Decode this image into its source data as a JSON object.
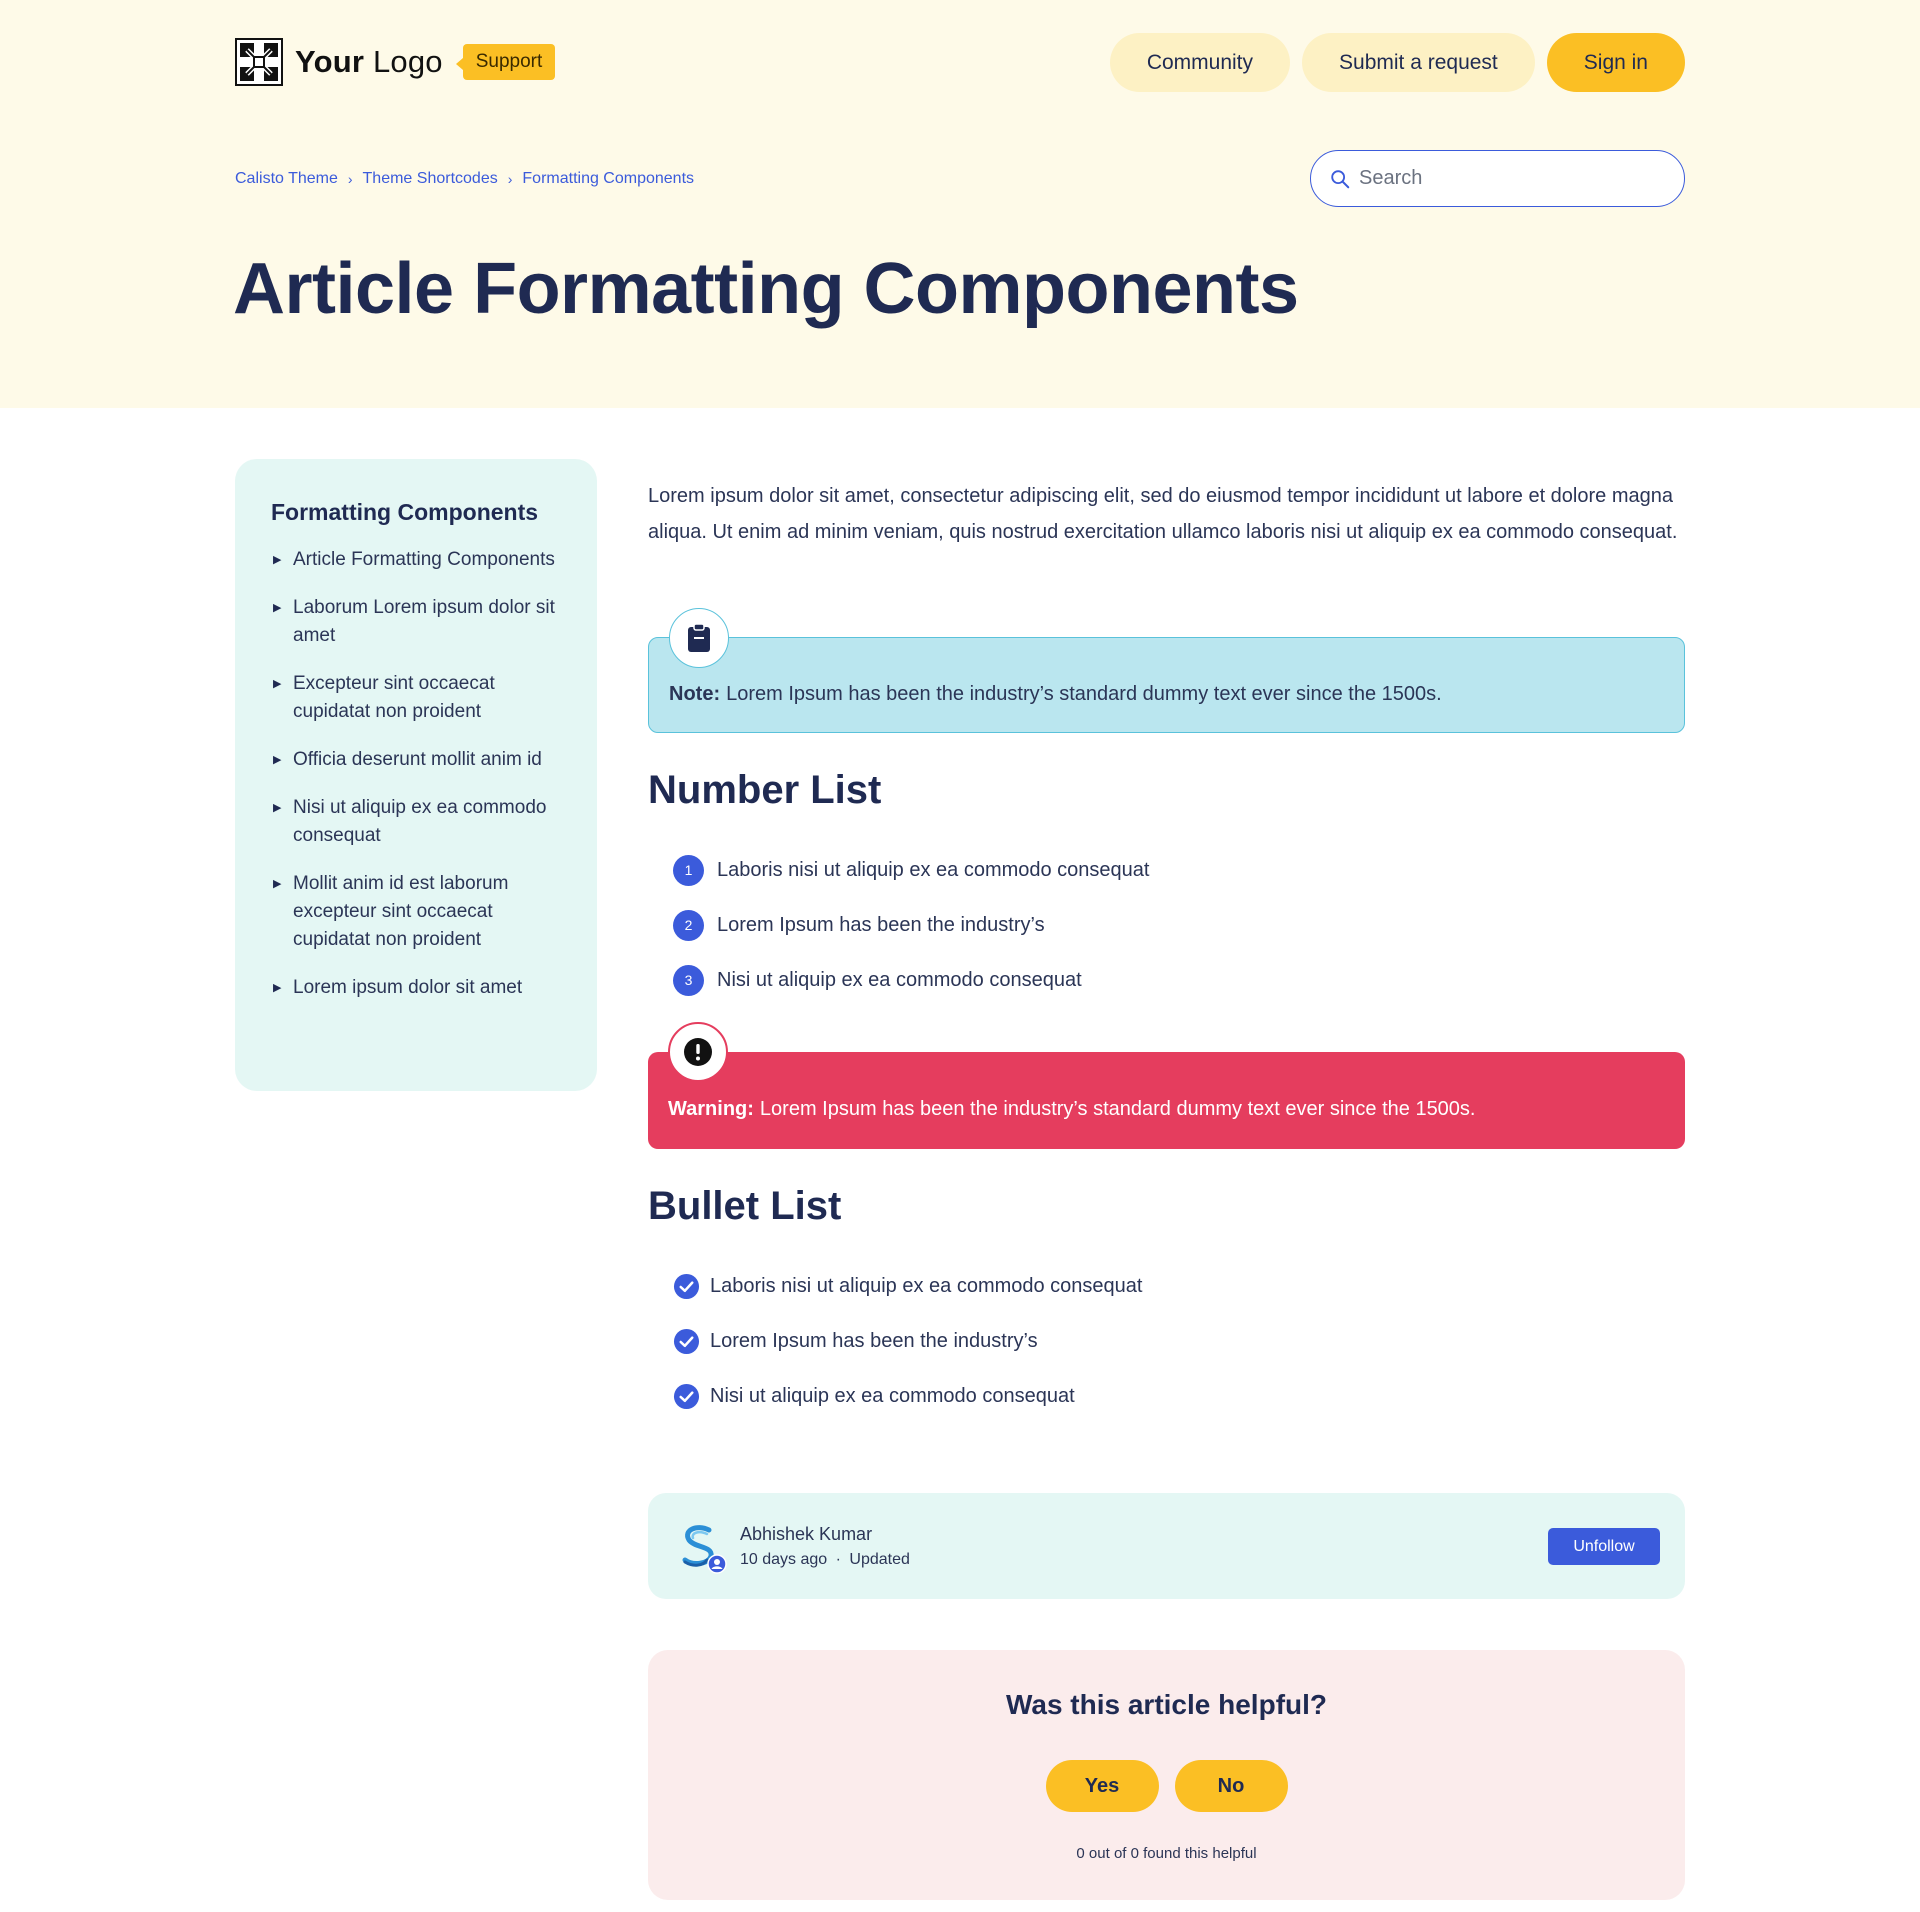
{
  "header": {
    "logo_bold": "Your",
    "logo_rest": " Logo",
    "support_badge": "Support",
    "nav": [
      {
        "label": "Community"
      },
      {
        "label": "Submit a request"
      },
      {
        "label": "Sign in"
      }
    ]
  },
  "breadcrumb": [
    "Calisto Theme",
    "Theme Shortcodes",
    "Formatting Components"
  ],
  "search": {
    "placeholder": "Search"
  },
  "page_title": "Article Formatting Components",
  "sidebar": {
    "title": "Formatting Components",
    "items": [
      {
        "label": "Article Formatting Components"
      },
      {
        "label": "Laborum Lorem ipsum dolor sit amet"
      },
      {
        "label": "Excepteur sint occaecat cupidatat non proident"
      },
      {
        "label": "Officia deserunt mollit anim id"
      },
      {
        "label": "Nisi ut aliquip ex ea commodo consequat"
      },
      {
        "label": "Mollit anim id est laborum excepteur sint occaecat cupidatat non proident"
      },
      {
        "label": "Lorem ipsum dolor sit amet"
      }
    ]
  },
  "article": {
    "intro": "Lorem ipsum dolor sit amet, consectetur adipiscing elit, sed do eiusmod tempor incididunt ut labore et dolore magna aliqua. Ut enim ad minim veniam, quis nostrud exercitation ullamco laboris nisi ut aliquip ex ea commodo consequat.",
    "note": {
      "label": "Note:",
      "text": "Lorem Ipsum has been the industry’s standard dummy text ever since the 1500s.",
      "icon": "clipboard-icon"
    },
    "number_list": {
      "heading": "Number List",
      "items": [
        {
          "num": "1",
          "text": "Laboris nisi ut aliquip ex ea commodo consequat"
        },
        {
          "num": "2",
          "text": "Lorem Ipsum has been the industry’s"
        },
        {
          "num": "3",
          "text": "Nisi ut aliquip ex ea commodo consequat"
        }
      ]
    },
    "warning": {
      "label": "Warning:",
      "text": "Lorem Ipsum has been the industry’s standard dummy text ever since the 1500s.",
      "icon": "exclamation-icon"
    },
    "bullet_list": {
      "heading": "Bullet List",
      "items": [
        {
          "text": "Laboris nisi ut aliquip ex ea commodo consequat"
        },
        {
          "text": "Lorem Ipsum has been the industry’s"
        },
        {
          "text": "Nisi ut aliquip ex ea commodo consequat"
        }
      ]
    }
  },
  "author": {
    "name": "Abhishek Kumar",
    "time": "10 days ago",
    "separator": "·",
    "status": "Updated",
    "follow_label": "Unfollow"
  },
  "vote": {
    "question": "Was this article helpful?",
    "yes": "Yes",
    "no": "No",
    "count_text": "0 out of 0 found this helpful"
  },
  "colors": {
    "hero_bg": "#fefae8",
    "accent_yellow": "#fbbf24",
    "accent_blue": "#3b5bdb",
    "note_bg": "#bae6ef",
    "warning_bg": "#e53d5e",
    "sidebar_bg": "#e4f7f4",
    "vote_bg": "#fbecec",
    "text_dark": "#1f2a52"
  }
}
